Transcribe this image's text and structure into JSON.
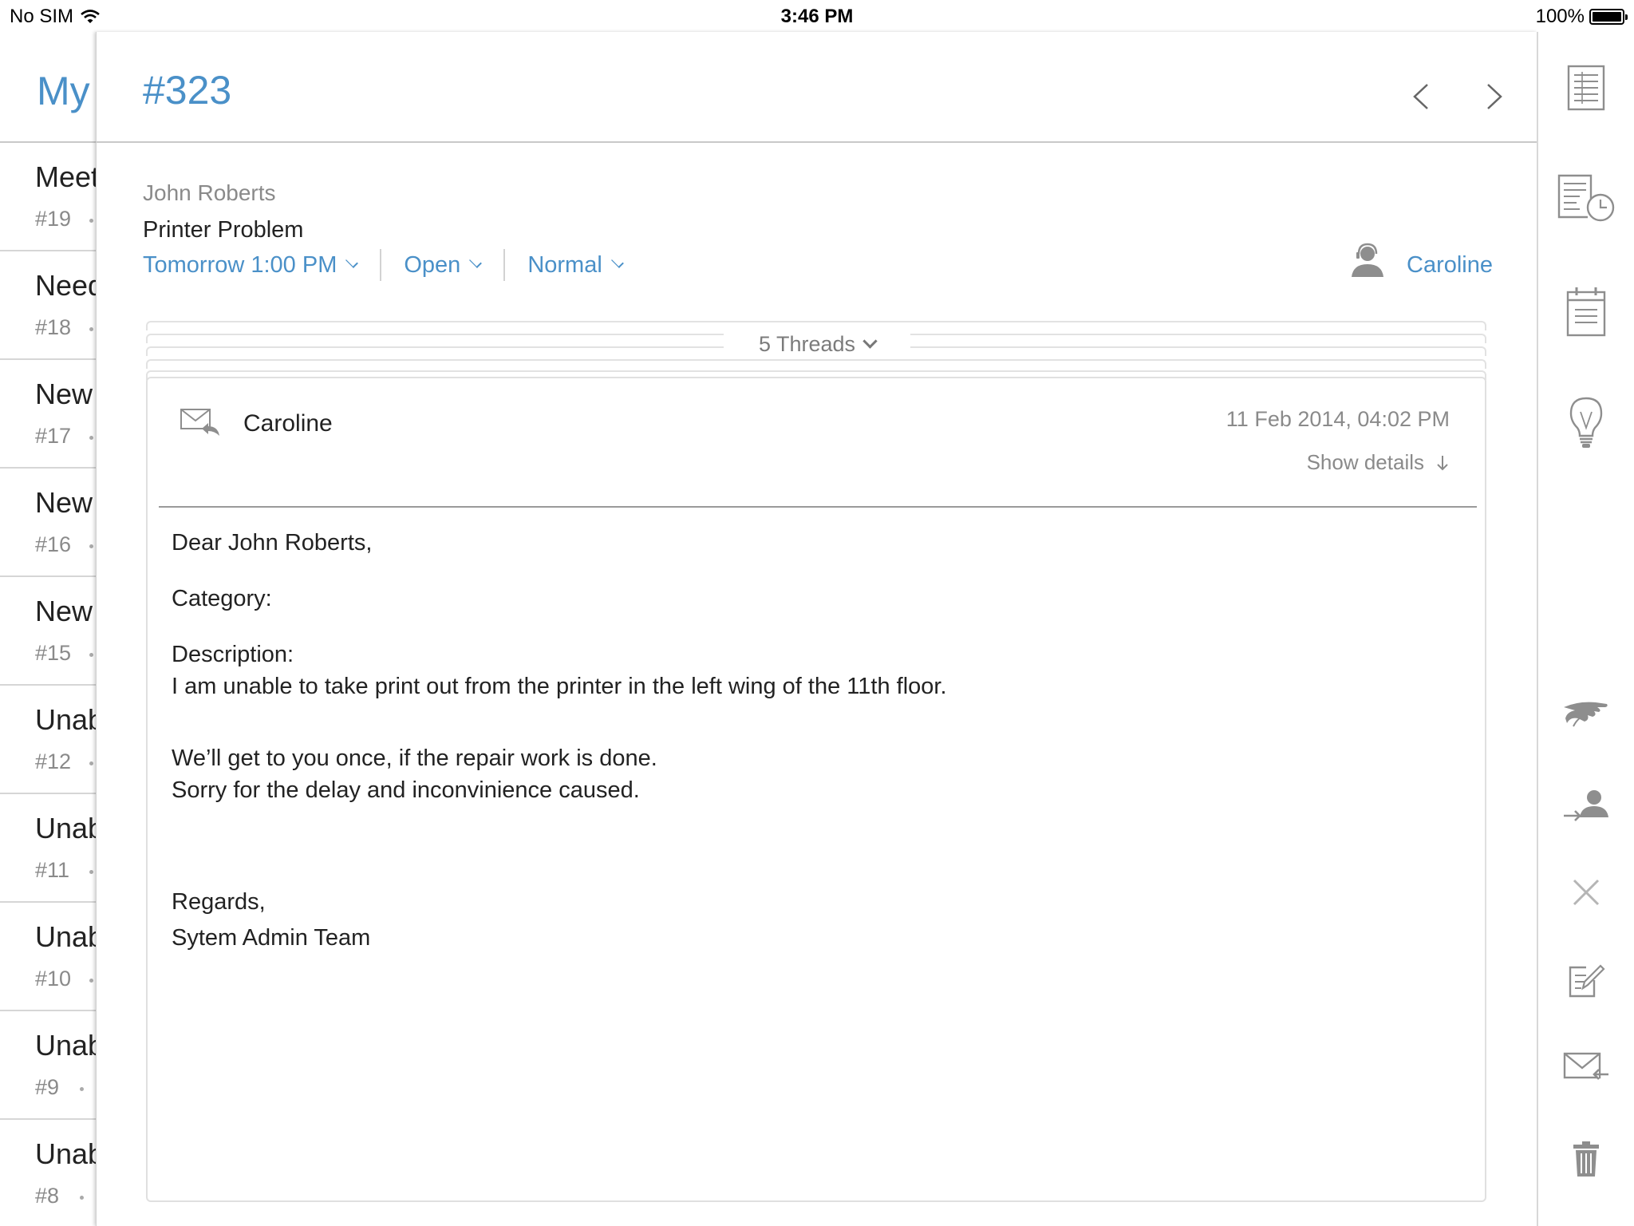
{
  "status_bar": {
    "carrier": "No SIM",
    "time": "3:46 PM",
    "battery": "100%"
  },
  "list": {
    "header": "My",
    "items": [
      {
        "title": "Meet",
        "number": "#19"
      },
      {
        "title": "Need",
        "number": "#18"
      },
      {
        "title": "New",
        "number": "#17"
      },
      {
        "title": "New",
        "number": "#16"
      },
      {
        "title": "New",
        "number": "#15"
      },
      {
        "title": "Unab",
        "number": "#12"
      },
      {
        "title": "Unab",
        "number": "#11"
      },
      {
        "title": "Unab",
        "number": "#10"
      },
      {
        "title": "Unab",
        "number": "#9"
      },
      {
        "title": "Unab",
        "number": "#8"
      }
    ]
  },
  "ticket": {
    "id": "#323",
    "requester": "John Roberts",
    "subject": "Printer Problem",
    "due": "Tomorrow 1:00 PM",
    "status": "Open",
    "priority": "Normal",
    "agent": "Caroline"
  },
  "threads": {
    "label": "5 Threads",
    "current": {
      "from": "Caroline",
      "date": "11 Feb 2014, 04:02 PM",
      "show_details": "Show details",
      "body": {
        "greeting": "Dear John Roberts,",
        "category": "Category:",
        "description_label": "Description:",
        "description": "I am unable to take print out from the printer in the left wing of the 11th floor.",
        "line1": "We’ll get to you once, if the repair work is done.",
        "line2": "Sorry for the delay and inconvinience caused.",
        "regards": "Regards,",
        "signature": "Sytem Admin Team"
      }
    }
  },
  "actions": [
    "list-view-icon",
    "time-entry-icon",
    "calendar-notes-icon",
    "lightbulb-icon",
    "pickup-hand-icon",
    "assign-user-icon",
    "close-icon",
    "edit-icon",
    "forward-mail-icon",
    "trash-icon"
  ],
  "colors": {
    "accent": "#4a90c8",
    "icon_gray": "#8e8e8e"
  }
}
